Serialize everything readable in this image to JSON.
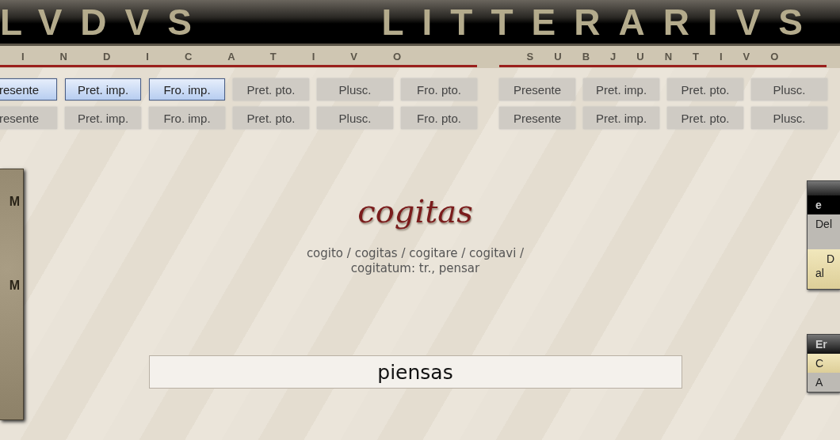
{
  "header": {
    "words": [
      "LVDVS",
      "LITTERARIVS"
    ]
  },
  "moods": [
    {
      "label": "INDICATIVO",
      "rows": [
        [
          {
            "label": "resente",
            "selected": true
          },
          {
            "label": "Pret. imp.",
            "selected": true
          },
          {
            "label": "Fro. imp.",
            "selected": true
          },
          {
            "label": "Pret. pto.",
            "selected": false
          },
          {
            "label": "Plusc.",
            "selected": false
          },
          {
            "label": "Fro. pto.",
            "selected": false
          }
        ],
        [
          {
            "label": "resente",
            "selected": false
          },
          {
            "label": "Pret. imp.",
            "selected": false
          },
          {
            "label": "Fro. imp.",
            "selected": false
          },
          {
            "label": "Pret. pto.",
            "selected": false
          },
          {
            "label": "Plusc.",
            "selected": false
          },
          {
            "label": "Fro. pto.",
            "selected": false
          }
        ]
      ]
    },
    {
      "label": "SUBJUNTIVO",
      "rows": [
        [
          {
            "label": "Presente",
            "selected": false
          },
          {
            "label": "Pret. imp.",
            "selected": false
          },
          {
            "label": "Pret. pto.",
            "selected": false
          },
          {
            "label": "Plusc.",
            "selected": false
          }
        ],
        [
          {
            "label": "Presente",
            "selected": false
          },
          {
            "label": "Pret. imp.",
            "selected": false
          },
          {
            "label": "Pret. pto.",
            "selected": false
          },
          {
            "label": "Plusc.",
            "selected": false
          }
        ]
      ]
    }
  ],
  "left_panel": {
    "items": [
      "M",
      "M"
    ]
  },
  "verb": {
    "word": "cogitas",
    "definition": "cogito / cogitas / cogitare / cogitavi / cogitatum: tr., pensar"
  },
  "answer": {
    "value": "piensas"
  },
  "right_panels": [
    {
      "rows": [
        {
          "kind": "cap"
        },
        {
          "kind": "header",
          "lines": [
            "e"
          ]
        },
        {
          "kind": "plain",
          "lines": [
            "Del"
          ]
        },
        {
          "kind": "highlight",
          "lines": [
            "D",
            "al"
          ]
        }
      ]
    },
    {
      "rows": [
        {
          "kind": "header",
          "lines": [
            "Er"
          ]
        },
        {
          "kind": "highlight",
          "lines": [
            "C"
          ]
        },
        {
          "kind": "plain",
          "lines": [
            "A"
          ]
        }
      ]
    }
  ]
}
